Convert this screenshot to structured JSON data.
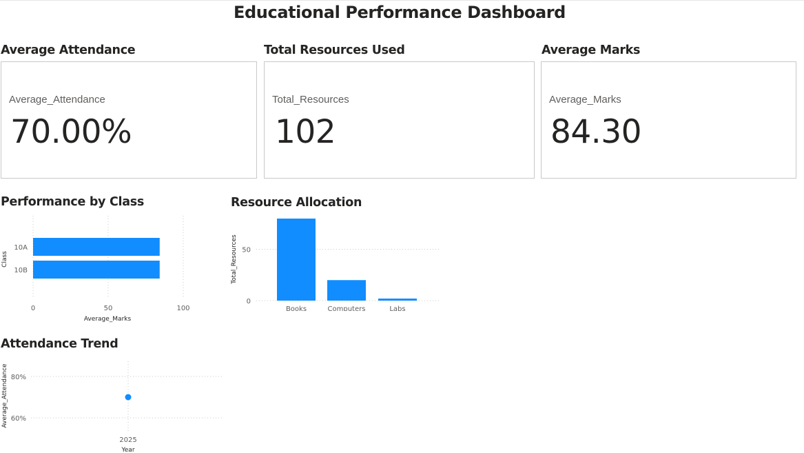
{
  "dashboard": {
    "title": "Educational Performance Dashboard"
  },
  "cards": [
    {
      "title": "Average Attendance",
      "label": "Average_Attendance",
      "value": "70.00%"
    },
    {
      "title": "Total Resources Used",
      "label": "Total_Resources",
      "value": "102"
    },
    {
      "title": "Average Marks",
      "label": "Average_Marks",
      "value": "84.30"
    }
  ],
  "charts": {
    "performance": {
      "title": "Performance by Class",
      "x_ticks": [
        "0",
        "50",
        "100"
      ],
      "y_ticks": [
        "10A",
        "10B"
      ]
    },
    "resources": {
      "title": "Resource Allocation",
      "y_ticks": [
        "0",
        "50"
      ],
      "x_ticks": [
        "Books",
        "Computers",
        "Labs"
      ]
    },
    "attendance": {
      "title": "Attendance Trend",
      "y_ticks": [
        "60%",
        "80%"
      ],
      "x_ticks": [
        "2025"
      ]
    }
  },
  "colors": {
    "accent": "#118DFF",
    "grid": "#c8c8c8",
    "border": "#c8c8c8"
  },
  "chart_data": [
    {
      "type": "bar",
      "orientation": "horizontal",
      "title": "Performance by Class",
      "categories": [
        "10A",
        "10B"
      ],
      "values": [
        84.3,
        84.3
      ],
      "xlabel": "Average_Marks",
      "ylabel": "Class",
      "xlim": [
        0,
        100
      ],
      "grid": true
    },
    {
      "type": "bar",
      "title": "Resource Allocation",
      "categories": [
        "Books",
        "Computers",
        "Labs"
      ],
      "values": [
        80,
        20,
        2
      ],
      "xlabel": "",
      "ylabel": "Total_Resources",
      "ylim": [
        0,
        80
      ],
      "grid": true
    },
    {
      "type": "scatter",
      "title": "Attendance Trend",
      "x": [
        "2025"
      ],
      "y": [
        0.7
      ],
      "xlabel": "Year",
      "ylabel": "Average_Attendance",
      "ylim": [
        0.55,
        0.85
      ],
      "grid": true
    }
  ]
}
